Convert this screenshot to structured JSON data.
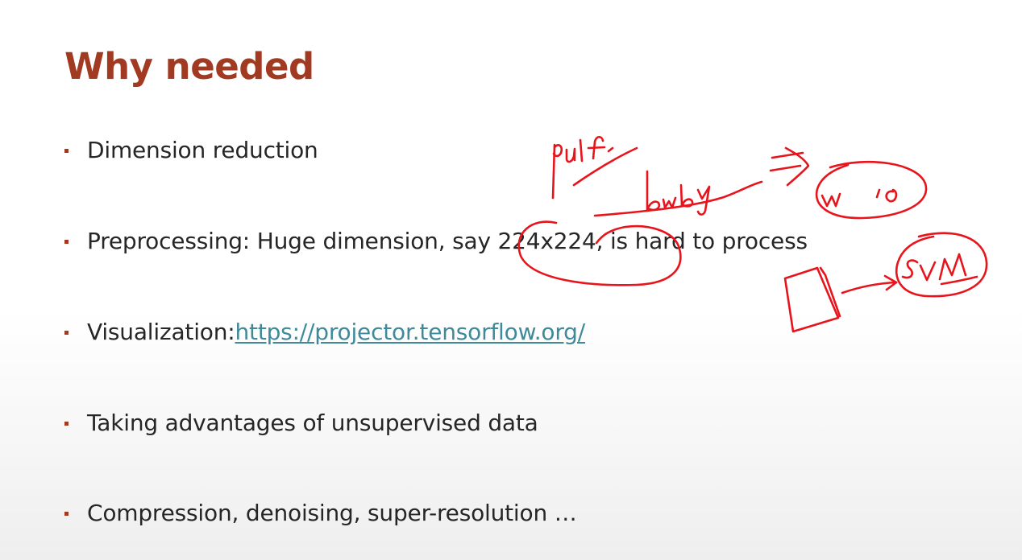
{
  "slide": {
    "title": "Why needed",
    "bullets": [
      {
        "text": "Dimension reduction"
      },
      {
        "text": "Preprocessing: Huge dimension, say 224x224, is hard to process"
      },
      {
        "prefix": "Visualization: ",
        "link": "https://projector.tensorflow.org/"
      },
      {
        "text": "Taking advantages of unsupervised data"
      },
      {
        "text": "Compression, denoising, super-resolution …"
      }
    ]
  },
  "annotations": {
    "handwritten_notes": [
      "pulf",
      "bwby",
      "w10",
      "SVM"
    ]
  },
  "colors": {
    "title": "#a23a22",
    "bullet_marker": "#a23a22",
    "body_text": "#262626",
    "link": "#3f8a9a",
    "ink": "#e8141c"
  }
}
